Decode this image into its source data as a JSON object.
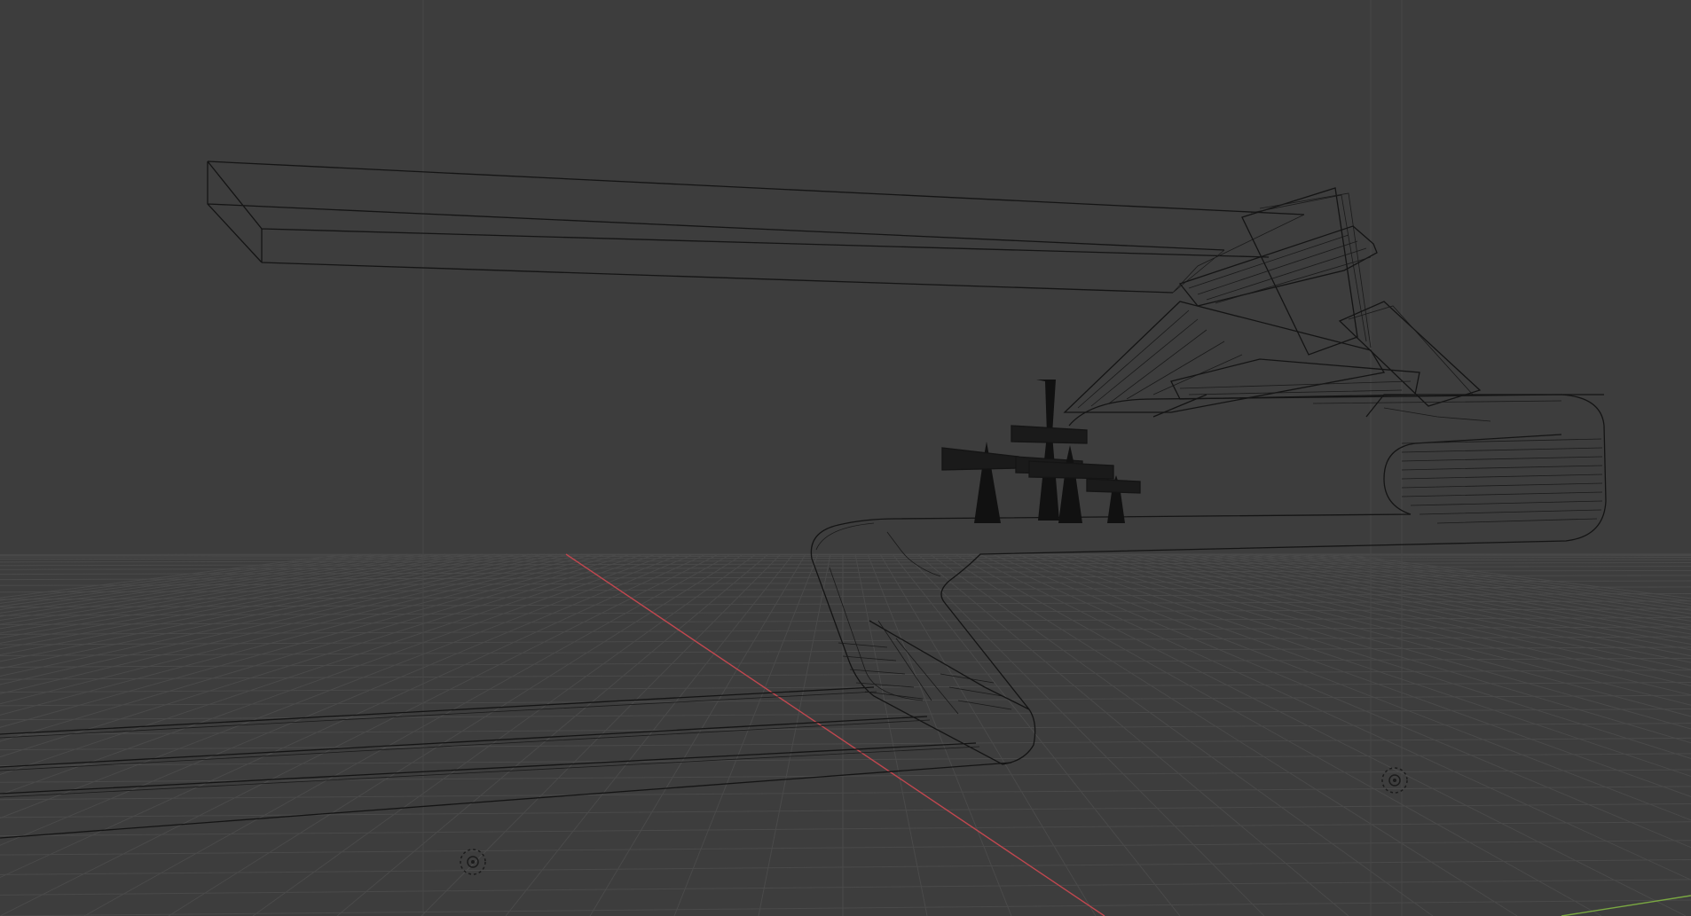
{
  "app": "3D viewport",
  "view": {
    "shading": "wireframe",
    "background": "#3d3d3d",
    "grid_color": "#4a4a4a",
    "x_axis_color": "#c0474f",
    "y_axis_color": "#7aa842",
    "wire_color": "#141414"
  },
  "objects": [
    {
      "name": "slab-overhang",
      "icon": "mesh-icon"
    },
    {
      "name": "curved-track",
      "icon": "mesh-icon"
    },
    {
      "name": "pylons",
      "icon": "mesh-icon"
    },
    {
      "name": "frames-upper",
      "icon": "mesh-icon"
    },
    {
      "name": "rails",
      "icon": "mesh-icon"
    }
  ],
  "lights": [
    {
      "icon": "light-icon"
    },
    {
      "icon": "light-icon"
    }
  ]
}
